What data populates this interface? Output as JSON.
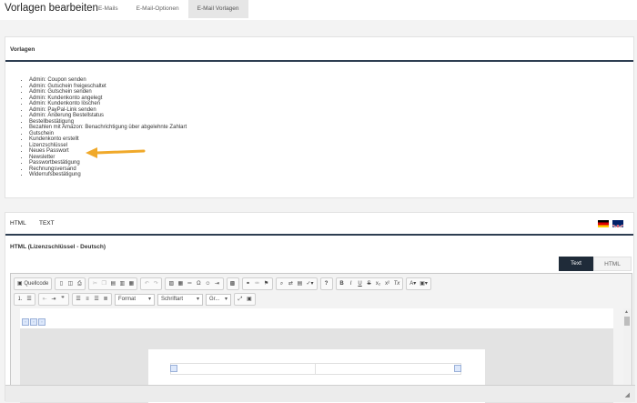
{
  "header": {
    "title": "Vorlagen bearbeiten",
    "tabs": [
      {
        "label": "E-Mails"
      },
      {
        "label": "E-Mail-Optionen"
      },
      {
        "label": "E-Mail Vorlagen"
      }
    ]
  },
  "templates_panel": {
    "title": "Vorlagen",
    "items": [
      "Admin: Coupon senden",
      "Admin: Gutschein freigeschaltet",
      "Admin: Gutschein senden",
      "Admin: Kundenkonto angelegt",
      "Admin: Kundenkonto löschen",
      "Admin: PayPal-Link senden",
      "Admin: Änderung Bestellstatus",
      "Bestellbestätigung",
      "Bezahlen mit Amazon: Benachrichtigung über abgelehnte Zahlart",
      "Gutschein",
      "Kundenkonto erstellt",
      "Lizenzschlüssel",
      "Neues Passwort",
      "Newsletter",
      "Passwortbestätigung",
      "Rechnungsversand",
      "Widerrufsbestätigung"
    ]
  },
  "editor_panel": {
    "tabs": [
      {
        "label": "HTML"
      },
      {
        "label": "TEXT"
      }
    ],
    "section_label": "HTML (Lizenzschlüssel - Deutsch)",
    "mode_tabs": {
      "text": "Text",
      "html": "HTML"
    },
    "toolbar": {
      "source_label": "Quellcode",
      "format": "Format",
      "font": "Schriftart",
      "size": "Gr..."
    }
  },
  "colors": {
    "accent_dark": "#1f2b39",
    "arrow": "#f0a92a"
  }
}
